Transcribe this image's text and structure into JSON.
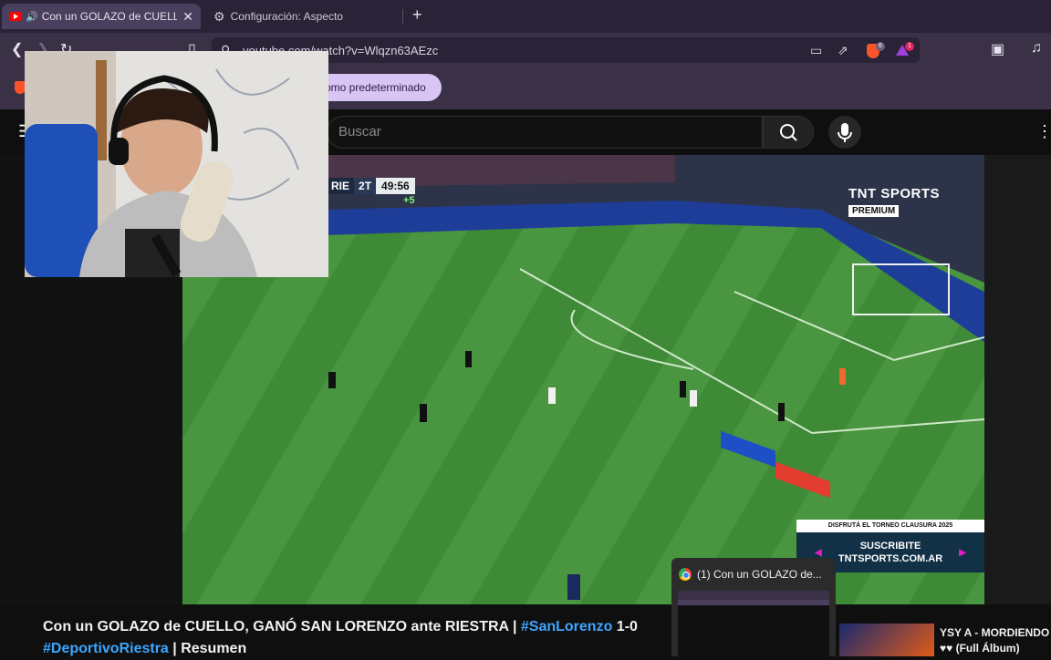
{
  "browser": {
    "tabs": [
      {
        "title": "Con un GOLAZO de CUELLO, GANÓ SAN LORENZO ante RIESTRA | #SanLorenzo 1-0 #DeportivoRiestra | Resumen",
        "close": "✕",
        "active": true
      },
      {
        "title": "Configuración: Aspecto",
        "active": false
      }
    ],
    "new_tab": "+",
    "url": "youtube.com/watch?v=Wlqzn63AEzc",
    "shield_count": "6",
    "rewards_count": "1",
    "infobar_button": "omo predeterminado"
  },
  "youtube": {
    "search_placeholder": "Buscar"
  },
  "broadcast": {
    "team": "RIE",
    "half": "2T",
    "clock": "49:56",
    "added_time": "+5",
    "network_line1": "TNT SPORTS",
    "network_line2": "PREMIUM",
    "promo_top": "DISFRUTÁ EL TORNEO CLAUSURA 2025",
    "promo_line1": "SUSCRIBITE",
    "promo_line2": "TNTSPORTS.COM.AR"
  },
  "video": {
    "title_part1": "Con un GOLAZO de CUELLO, GANÓ SAN LORENZO ante RIESTRA | ",
    "hashtag1": "#SanLorenzo",
    "title_part2": " 1-0",
    "hashtag2": "#DeportivoRiestra",
    "title_part3": " | Resumen"
  },
  "taskbar_preview": {
    "title": "(1) Con un GOLAZO de..."
  },
  "suggested": {
    "title_line1": "YSY A - MORDIENDO EL",
    "title_line2": "♥♥ (Full Álbum)"
  },
  "colors": {
    "accent_hashtag": "#3ea6ff",
    "brave_orange": "#fb542b",
    "pitch_green": "#3f8a3a"
  }
}
